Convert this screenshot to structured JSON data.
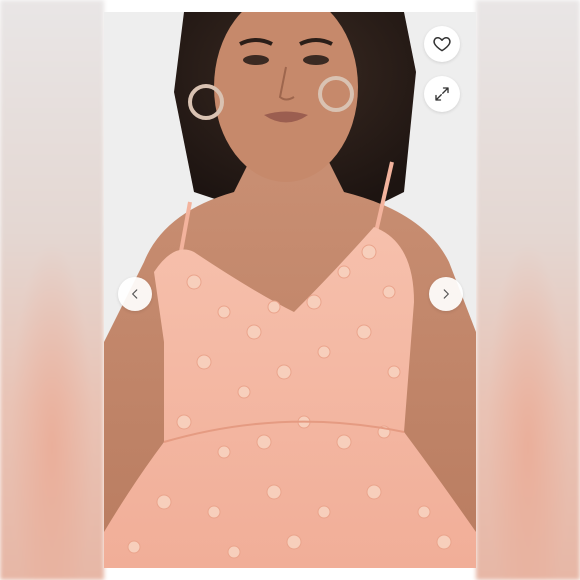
{
  "viewer": {
    "controls": {
      "favorite_icon": "heart-outline-icon",
      "expand_icon": "expand-arrows-icon",
      "prev_icon": "chevron-left-icon",
      "next_icon": "chevron-right-icon"
    },
    "colors": {
      "dress": "#f4b7a2",
      "flowers": "#f6c8b3",
      "backdrop": "#eeeeee",
      "control_bg": "#ffffff",
      "icon": "#333333"
    }
  }
}
